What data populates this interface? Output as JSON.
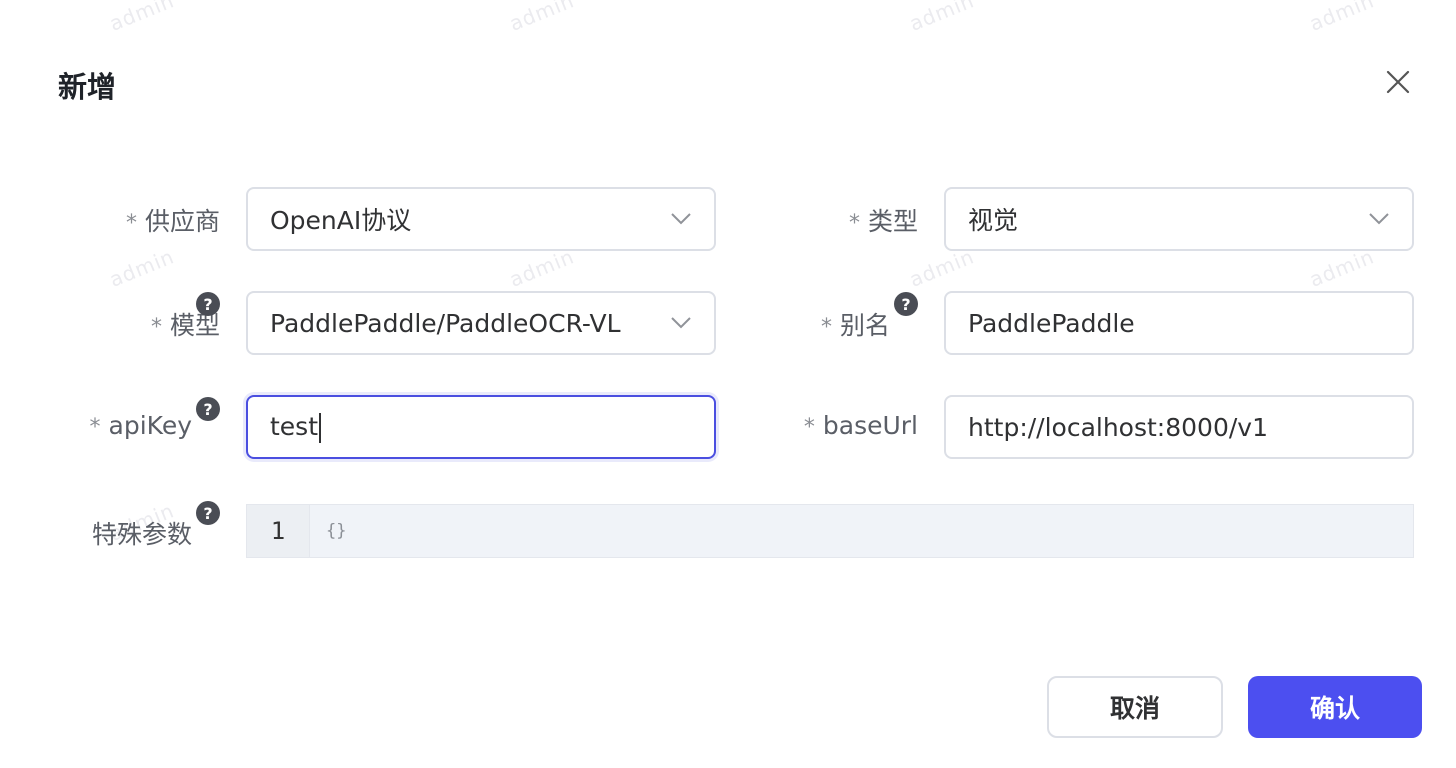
{
  "watermark_text": "admin",
  "dialog": {
    "title": "新增"
  },
  "form": {
    "required_mark": "*",
    "help_mark": "?",
    "provider": {
      "label": "供应商",
      "value": "OpenAI协议"
    },
    "type": {
      "label": "类型",
      "value": "视觉"
    },
    "model": {
      "label": "模型",
      "value": "PaddlePaddle/PaddleOCR-VL"
    },
    "alias": {
      "label": "别名",
      "value": "PaddlePaddle"
    },
    "api_key": {
      "label": "apiKey",
      "value": "test"
    },
    "base_url": {
      "label": "baseUrl",
      "value": "http://localhost:8000/v1"
    },
    "special_params": {
      "label": "特殊参数",
      "line_number": "1",
      "code": "{}"
    }
  },
  "footer": {
    "cancel_label": "取消",
    "confirm_label": "确认"
  },
  "colors": {
    "primary": "#4c4ff0",
    "focus_border": "#4b4fe0"
  },
  "icons": [
    "close-icon",
    "chevron-down-icon",
    "help-icon"
  ]
}
